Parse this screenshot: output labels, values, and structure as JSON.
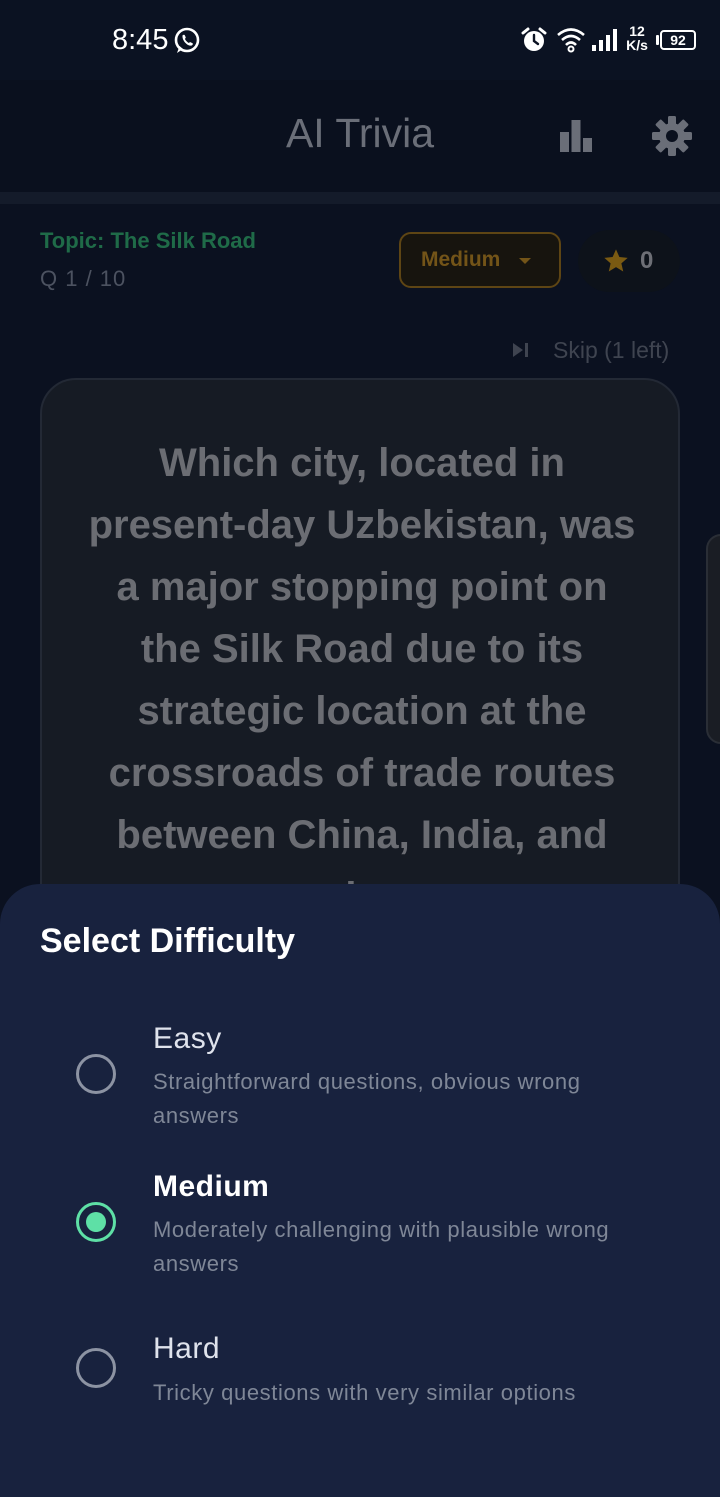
{
  "status_bar": {
    "time": "8:45",
    "net_speed_value": "12",
    "net_speed_unit": "K/s",
    "battery": "92"
  },
  "app_bar": {
    "title": "AI Trivia",
    "stats_icon": "bar-chart-icon",
    "settings_icon": "gear-icon"
  },
  "quiz": {
    "topic": "Topic: The Silk Road",
    "progress": "Q 1 / 10",
    "difficulty_chip": "Medium",
    "score": "0",
    "skip_label": "Skip (1 left)",
    "question": "Which city, located in present-day Uzbekistan, was a major stopping point on the Silk Road due to its strategic location at the crossroads of trade routes between China, India, and the"
  },
  "difficulty_sheet": {
    "title": "Select Difficulty",
    "selected": "Medium",
    "options": [
      {
        "label": "Easy",
        "description": "Straightforward questions, obvious wrong answers"
      },
      {
        "label": "Medium",
        "description": "Moderately challenging with plausible wrong answers"
      },
      {
        "label": "Hard",
        "description": "Tricky questions with very similar options"
      }
    ]
  },
  "colors": {
    "accent_green": "#5ee0a6",
    "sheet_bg": "#18223e",
    "chip_gold": "#735418"
  }
}
